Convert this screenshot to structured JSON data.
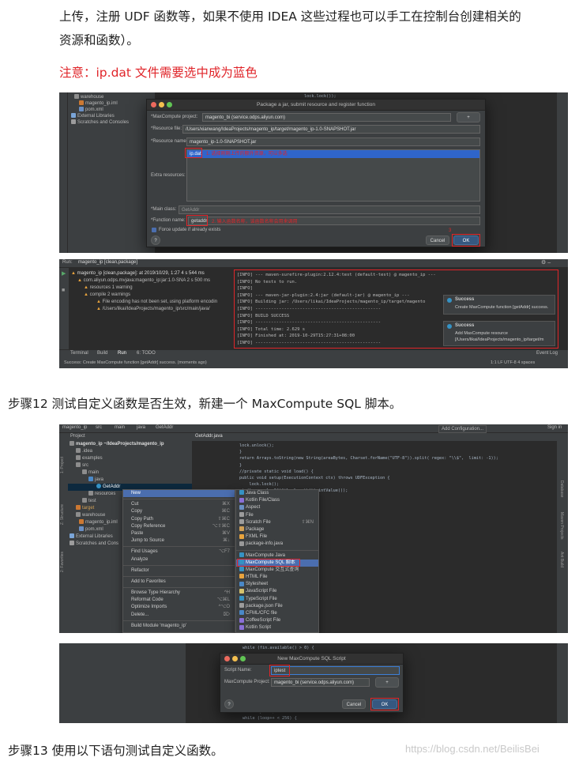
{
  "doc": {
    "para1_line1": "上传，注册 UDF 函数等，如果不使用 IDEA 这些过程也可以手工在控制台创建相关的",
    "para1_line2": "资源和函数）。",
    "warning": "注意：ip.dat 文件需要选中成为蓝色",
    "step12": "步骤12 测试自定义函数是否生效，新建一个 MaxCompute SQL 脚本。",
    "step13": "步骤13 使用以下语句测试自定义函数。",
    "watermark": "https://blog.csdn.net/BeilisBei"
  },
  "shot1": {
    "tree": [
      "warehouse",
      "magento_ip.iml",
      "pom.xml",
      "External Libraries",
      "Scratches and Consoles"
    ],
    "code_top": "lock.lock());",
    "dialog_title": "Package a jar, submit resource and register function",
    "maxcompute_project_label": "*MaxCompute project:",
    "maxcompute_project_value": "magento_bi (service.odps.aliyun.com)",
    "resource_file_label": "*Resource file:",
    "resource_file_value": "/Users/xianwang/IdeaProjects/magento_ip/target/magento_ip-1.0-SNAPSHOT.jar",
    "resource_name_label": "*Resource name:",
    "resource_name_value": "magento_ip-1.0-SNAPSHOT.jar",
    "extra_resources_label": "Extra resources:",
    "extra_item": "ip.dat",
    "extra_note": "1. 选择刚刚上传的额外资源，可以多选",
    "main_class_label": "*Main class:",
    "main_class_value": "GetAddr",
    "function_name_label": "*Function name:",
    "function_name_value": "getaddr",
    "function_note": "2. 输入函数名称，该函数名称会用来调用",
    "force_update": "Force update if already exists",
    "help": "?",
    "cancel": "Cancel",
    "ok": "OK",
    "step_num": "3"
  },
  "shot2": {
    "run_tab": "Run:",
    "run_config": "magento_ip [clean,package]",
    "tree": [
      "magento_ip [clean,package]: at 2019/10/29, 1:27 4 s 544 ms",
      "com.aliyun.odps.mvjava:magento_ip:jar:1.0-SNA  2 s 500 ms",
      "resources  1 warning",
      "compile  2 warnings",
      "File encoding has not been set, using platform encodin",
      "/Users/likai/IdeaProjects/magento_ip/src/main/java/"
    ],
    "console": [
      "[INFO] --- maven-surefire-plugin:2.12.4:test (default-test) @ magento_ip ---",
      "[INFO] No tests to run.",
      "[INFO]",
      "[INFO] --- maven-jar-plugin:2.4:jar (default-jar) @ magento_ip ---",
      "[INFO] Building jar: /Users/likai/IdeaProjects/magento_ip/target/magento",
      "[INFO] ------------------------------------------------",
      "[INFO] BUILD SUCCESS",
      "[INFO] ------------------------------------------------",
      "[INFO] Total time:  2.629 s",
      "[INFO] Finished at: 2019-10-29T15:27:31+08:00",
      "[INFO] ------------------------------------------------"
    ],
    "notif1_title": "Success",
    "notif1_body": "Create MaxCompute function [getAddr] success.",
    "notif2_title": "Success",
    "notif2_body1": "Add MaxCompute resource",
    "notif2_body2": "[/Users/likai/IdeaProjects/magento_ip/target/m",
    "tabs": [
      "Terminal",
      "Build",
      "Run",
      "6: TODO"
    ],
    "event_log": "Event Log",
    "status": "Success: Create MaxCompute function [getAddr] success. (moments ago)",
    "status_right": "1:1  LF  UTF-8  4 spaces"
  },
  "shot3": {
    "breadcrumb": [
      "magento_ip",
      "src",
      "main",
      "java",
      "GetAddr"
    ],
    "add_config": "Add Configuration...",
    "sign_in": "Sign in",
    "project_label": "Project",
    "file_tab": "GetAddr.java",
    "tree": [
      "magento_ip ~/IdeaProjects/magento_ip",
      ".idea",
      "examples",
      "src",
      "main",
      "java",
      "GetAddr",
      "resources",
      "test",
      "target",
      "warehouse",
      "magento_ip.iml",
      "pom.xml",
      "External Libraries",
      "Scratches and Cons"
    ],
    "menu": [
      {
        "label": "New",
        "sc": ""
      },
      {
        "label": "Cut",
        "sc": "⌘X"
      },
      {
        "label": "Copy",
        "sc": "⌘C"
      },
      {
        "label": "Copy Path",
        "sc": "⇧⌘C"
      },
      {
        "label": "Copy Reference",
        "sc": "⌥⇧⌘C"
      },
      {
        "label": "Paste",
        "sc": "⌘V"
      },
      {
        "label": "Jump to Source",
        "sc": "⌘↓"
      },
      {
        "label": "Find Usages",
        "sc": "⌥F7"
      },
      {
        "label": "Analyze",
        "sc": ""
      },
      {
        "label": "Refactor",
        "sc": ""
      },
      {
        "label": "Add to Favorites",
        "sc": ""
      },
      {
        "label": "Browse Type Hierarchy",
        "sc": "^H"
      },
      {
        "label": "Reformat Code",
        "sc": "⌥⌘L"
      },
      {
        "label": "Optimize Imports",
        "sc": "^⌥O"
      },
      {
        "label": "Delete...",
        "sc": "⌦"
      },
      {
        "label": "Build Module 'magento_ip'",
        "sc": ""
      }
    ],
    "submenu": [
      "Java Class",
      "Kotlin File/Class",
      "Aspect",
      "File",
      "Scratch File",
      "Package",
      "FXML File",
      "package-info.java",
      "MaxCompute Java",
      "MaxCompute SQL 脚本",
      "MaxCompute 交互式查询",
      "HTML File",
      "Stylesheet",
      "JavaScript File",
      "TypeScript File",
      "package.json File",
      "CFML/CFC file",
      "CoffeeScript File",
      "Kotlin Script"
    ],
    "submenu_sc": "⇧⌘N",
    "side_tabs": [
      "1: Project",
      "Z: Structure",
      "2: Favorites"
    ],
    "right_tabs": [
      "Database",
      "Maven Projects",
      "Ant Build"
    ],
    "code": [
      "lock.unlock();",
      "}",
      "",
      "return Arrays.toString(new String(areaBytes, Charset.forName(\"UTF-8\")).split( regex: \"\\\\$\",  limit: -1));",
      "}",
      "",
      "",
      "//private static void load() {",
      "public void setup(ExecutionContext ctx) throws UDFException {",
      "    lock.lock();",
      "",
      "",
      "",
      "ate(Long.valueOf(file.length()).intValue());",
      "e(14057479);",
      "ourceFileAsStream( s: \"ip.dat\");",
      "le);",
      "",
      "",
      "chunk);",
      "0, readBytesLength);",
      "",
      "",
      "etInt();",
      "dexLength];",
      "0,  length: indexLength - 4);",
      "ndexBytes);",
      "TTLE_ENDIAN);",
      "",
      "",
      "",
      "",
      "",
      "",
      "er.getInt();"
    ]
  },
  "shot4": {
    "dialog_title": "New MaxCompute SQL Script",
    "script_name_label": "Script Name:",
    "script_name_value": "iptest",
    "project_label": "MaxCompute Project:",
    "project_value": "magento_bi (service.odps.aliyun.com)",
    "help": "?",
    "cancel": "Cancel",
    "ok": "OK",
    "code_top": "while (fin.available() > 0) {",
    "code_bottom1": "int loop = 0;",
    "code_bottom2": "while (loop++ < 256) {"
  }
}
